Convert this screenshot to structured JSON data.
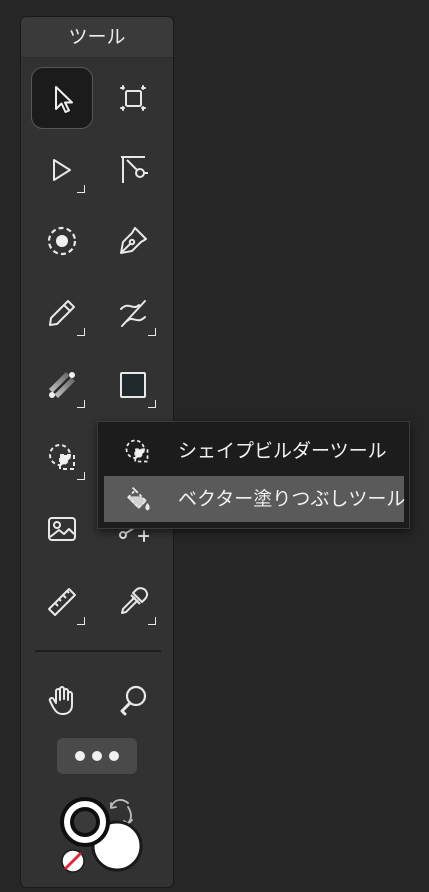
{
  "panel": {
    "title": "ツール",
    "tools": [
      {
        "name": "select-tool",
        "active": true,
        "corner": false
      },
      {
        "name": "artboard-tool",
        "active": false,
        "corner": false
      },
      {
        "name": "node-tool",
        "active": false,
        "corner": true
      },
      {
        "name": "corner-tool",
        "active": false,
        "corner": false
      },
      {
        "name": "transform-tool",
        "active": false,
        "corner": false
      },
      {
        "name": "pen-tool",
        "active": false,
        "corner": false
      },
      {
        "name": "pencil-tool",
        "active": false,
        "corner": true
      },
      {
        "name": "knife-tool",
        "active": false,
        "corner": true
      },
      {
        "name": "gradient-tool",
        "active": false,
        "corner": true
      },
      {
        "name": "rectangle-tool",
        "active": false,
        "corner": true
      },
      {
        "name": "shape-builder-tool",
        "active": false,
        "corner": true
      },
      {
        "name": "connector-tool",
        "active": false,
        "corner": false
      },
      {
        "name": "image-tool",
        "active": false,
        "corner": false
      },
      {
        "name": "ruler-tool",
        "active": false,
        "corner": true
      },
      {
        "name": "eyedropper-tool",
        "active": false,
        "corner": true
      },
      {
        "name": "hand-tool",
        "active": false,
        "corner": false
      },
      {
        "name": "zoom-tool",
        "active": false,
        "corner": false
      }
    ]
  },
  "flyout": {
    "items": [
      {
        "label": "シェイプビルダーツール",
        "icon": "shape-builder-icon",
        "selected": false
      },
      {
        "label": "ベクター塗りつぶしツール",
        "icon": "vector-fill-icon",
        "selected": true
      }
    ]
  },
  "colors": {
    "panel_bg": "#323232",
    "fill_swatch": "#1a1a1a",
    "stroke_swatch": "#ffffff",
    "none_slash": "#d92c3c"
  }
}
